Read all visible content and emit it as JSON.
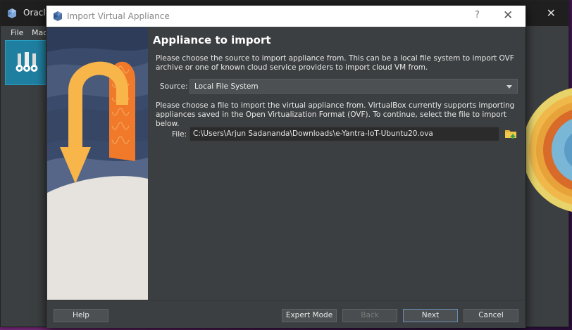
{
  "background_window": {
    "title": "Oracle",
    "menu": [
      "File",
      "Mach"
    ],
    "tools_label": "T"
  },
  "dialog": {
    "title": "Import Virtual Appliance",
    "help_glyph": "?",
    "close_glyph": "✕",
    "heading": "Appliance to import",
    "intro_text": "Please choose the source to import appliance from. This can be a local file system to import OVF archive or one of known cloud service providers to import cloud VM from.",
    "source_label": "Source:",
    "source_value": "Local File System",
    "file_intro_text": "Please choose a file to import the virtual appliance from. VirtualBox currently supports importing appliances saved in the Open Virtualization Format (OVF). To continue, select the file to import below.",
    "file_label": "File:",
    "file_value": "C:\\Users\\Arjun Sadananda\\Downloads\\e-Yantra-IoT-Ubuntu20.ova",
    "buttons": {
      "help": "Help",
      "expert_mode": "Expert Mode",
      "back": "Back",
      "next": "Next",
      "cancel": "Cancel"
    }
  },
  "colors": {
    "dialog_bg": "#3c3f41",
    "title_bar": "#ffffff",
    "accent_orange": "#f5a623",
    "tools_panel": "#1f7fa0"
  },
  "icons": {
    "app_logo": "virtualbox-logo-icon",
    "folder": "folder-open-icon",
    "dropdown": "chevron-down-icon"
  }
}
